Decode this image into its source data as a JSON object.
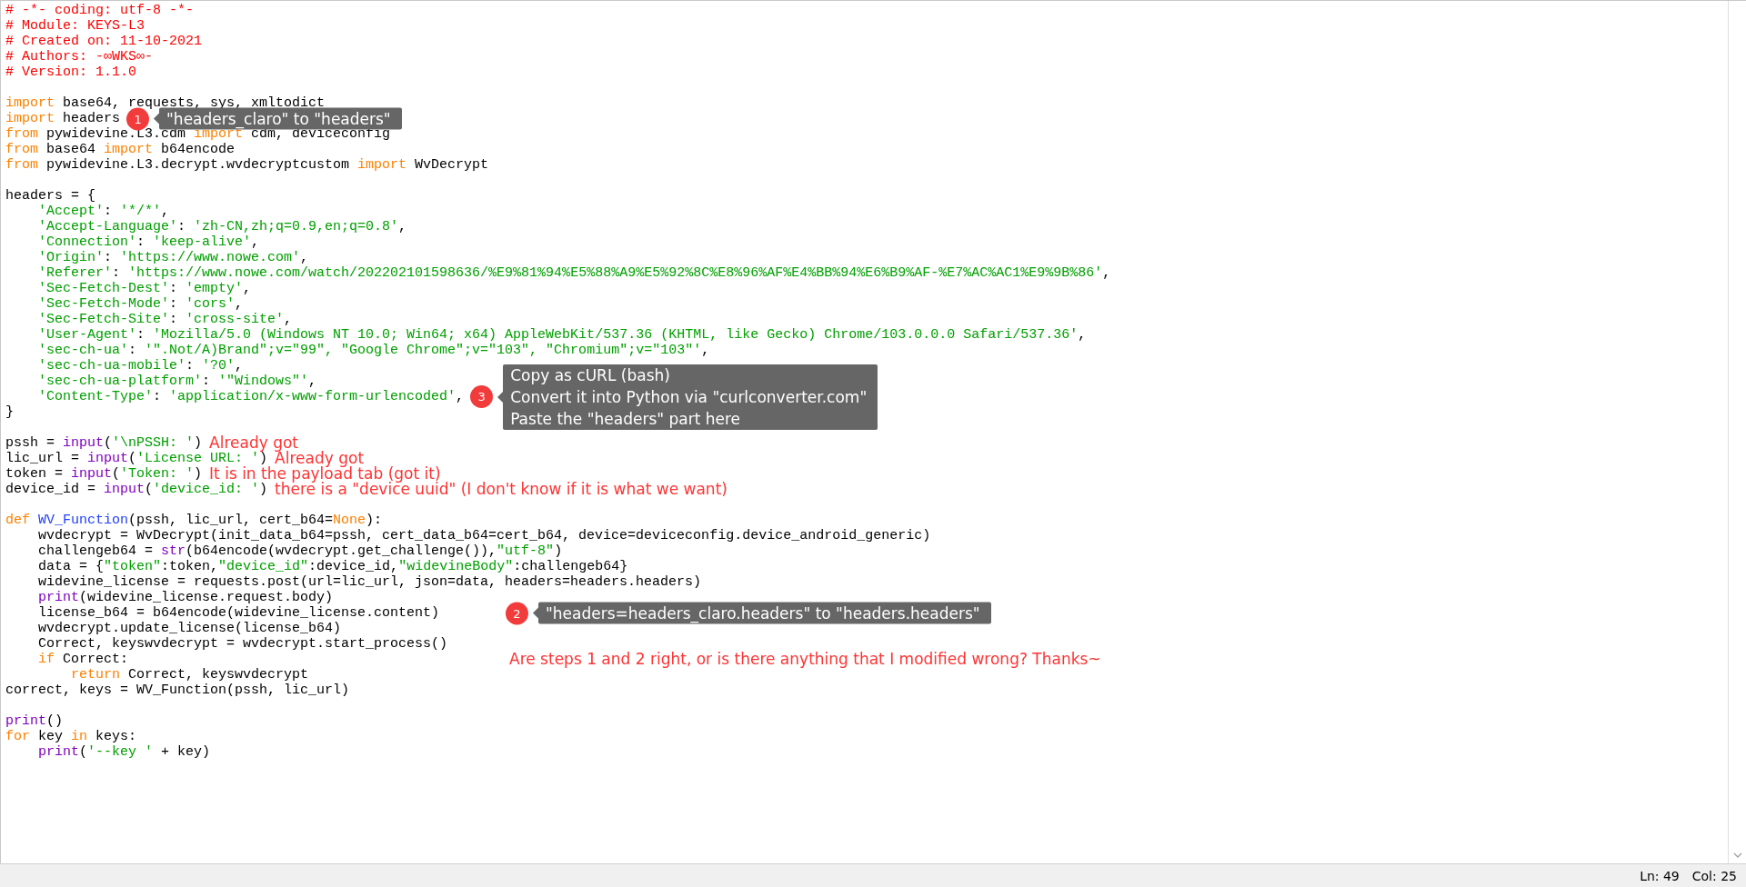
{
  "editor": {
    "lines": [
      {
        "kind": "code",
        "tokens": [
          {
            "kind": "comment",
            "text": "# -*- coding: utf-8 -*-"
          }
        ]
      },
      {
        "kind": "code",
        "tokens": [
          {
            "kind": "comment",
            "text": "# Module: KEYS-L3"
          }
        ]
      },
      {
        "kind": "code",
        "tokens": [
          {
            "kind": "comment",
            "text": "# Created on: 11-10-2021"
          }
        ]
      },
      {
        "kind": "code",
        "tokens": [
          {
            "kind": "comment",
            "text": "# Authors: -∞WKS∞-"
          }
        ]
      },
      {
        "kind": "code",
        "tokens": [
          {
            "kind": "comment",
            "text": "# Version: 1.1.0"
          }
        ]
      },
      {
        "kind": "blank"
      },
      {
        "kind": "code",
        "tokens": [
          {
            "kind": "kw",
            "text": "import"
          },
          {
            "kind": "plain",
            "text": " base64, requests, sys, xmltodict"
          }
        ]
      },
      {
        "kind": "code",
        "tokens": [
          {
            "kind": "kw",
            "text": "import"
          },
          {
            "kind": "plain",
            "text": " headers"
          }
        ],
        "annotation": {
          "kind": "callout",
          "aside": false,
          "number": "1",
          "lines": [
            "\"headers_claro\" to \"headers\""
          ]
        }
      },
      {
        "kind": "code",
        "tokens": [
          {
            "kind": "kw",
            "text": "from"
          },
          {
            "kind": "plain",
            "text": " pywidevine.L3.cdm "
          },
          {
            "kind": "kw",
            "text": "import"
          },
          {
            "kind": "plain",
            "text": " cdm, deviceconfig"
          }
        ]
      },
      {
        "kind": "code",
        "tokens": [
          {
            "kind": "kw",
            "text": "from"
          },
          {
            "kind": "plain",
            "text": " base64 "
          },
          {
            "kind": "kw",
            "text": "import"
          },
          {
            "kind": "plain",
            "text": " b64encode"
          }
        ]
      },
      {
        "kind": "code",
        "tokens": [
          {
            "kind": "kw",
            "text": "from"
          },
          {
            "kind": "plain",
            "text": " pywidevine.L3.decrypt.wvdecryptcustom "
          },
          {
            "kind": "kw",
            "text": "import"
          },
          {
            "kind": "plain",
            "text": " WvDecrypt"
          }
        ]
      },
      {
        "kind": "blank"
      },
      {
        "kind": "code",
        "tokens": [
          {
            "kind": "plain",
            "text": "headers = {"
          }
        ]
      },
      {
        "kind": "code",
        "tokens": [
          {
            "kind": "str",
            "text": "    'Accept'"
          },
          {
            "kind": "plain",
            "text": ": "
          },
          {
            "kind": "str",
            "text": "'*/*'"
          },
          {
            "kind": "plain",
            "text": ","
          }
        ]
      },
      {
        "kind": "code",
        "tokens": [
          {
            "kind": "str",
            "text": "    'Accept-Language'"
          },
          {
            "kind": "plain",
            "text": ": "
          },
          {
            "kind": "str",
            "text": "'zh-CN,zh;q=0.9,en;q=0.8'"
          },
          {
            "kind": "plain",
            "text": ","
          }
        ]
      },
      {
        "kind": "code",
        "tokens": [
          {
            "kind": "str",
            "text": "    'Connection'"
          },
          {
            "kind": "plain",
            "text": ": "
          },
          {
            "kind": "str",
            "text": "'keep-alive'"
          },
          {
            "kind": "plain",
            "text": ","
          }
        ]
      },
      {
        "kind": "code",
        "tokens": [
          {
            "kind": "str",
            "text": "    'Origin'"
          },
          {
            "kind": "plain",
            "text": ": "
          },
          {
            "kind": "str",
            "text": "'https://www.nowe.com'"
          },
          {
            "kind": "plain",
            "text": ","
          }
        ]
      },
      {
        "kind": "code",
        "tokens": [
          {
            "kind": "str",
            "text": "    'Referer'"
          },
          {
            "kind": "plain",
            "text": ": "
          },
          {
            "kind": "str",
            "text": "'https://www.nowe.com/watch/202202101598636/%E9%81%94%E5%88%A9%E5%92%8C%E8%96%AF%E4%BB%94%E6%B9%AF-%E7%AC%AC1%E9%9B%86'"
          },
          {
            "kind": "plain",
            "text": ","
          }
        ]
      },
      {
        "kind": "code",
        "tokens": [
          {
            "kind": "str",
            "text": "    'Sec-Fetch-Dest'"
          },
          {
            "kind": "plain",
            "text": ": "
          },
          {
            "kind": "str",
            "text": "'empty'"
          },
          {
            "kind": "plain",
            "text": ","
          }
        ]
      },
      {
        "kind": "code",
        "tokens": [
          {
            "kind": "str",
            "text": "    'Sec-Fetch-Mode'"
          },
          {
            "kind": "plain",
            "text": ": "
          },
          {
            "kind": "str",
            "text": "'cors'"
          },
          {
            "kind": "plain",
            "text": ","
          }
        ]
      },
      {
        "kind": "code",
        "tokens": [
          {
            "kind": "str",
            "text": "    'Sec-Fetch-Site'"
          },
          {
            "kind": "plain",
            "text": ": "
          },
          {
            "kind": "str",
            "text": "'cross-site'"
          },
          {
            "kind": "plain",
            "text": ","
          }
        ]
      },
      {
        "kind": "code",
        "tokens": [
          {
            "kind": "str",
            "text": "    'User-Agent'"
          },
          {
            "kind": "plain",
            "text": ": "
          },
          {
            "kind": "str",
            "text": "'Mozilla/5.0 (Windows NT 10.0; Win64; x64) AppleWebKit/537.36 (KHTML, like Gecko) Chrome/103.0.0.0 Safari/537.36'"
          },
          {
            "kind": "plain",
            "text": ","
          }
        ]
      },
      {
        "kind": "code",
        "tokens": [
          {
            "kind": "str",
            "text": "    'sec-ch-ua'"
          },
          {
            "kind": "plain",
            "text": ": "
          },
          {
            "kind": "str",
            "text": "'\".Not/A)Brand\";v=\"99\", \"Google Chrome\";v=\"103\", \"Chromium\";v=\"103\"'"
          },
          {
            "kind": "plain",
            "text": ","
          }
        ]
      },
      {
        "kind": "code",
        "tokens": [
          {
            "kind": "str",
            "text": "    'sec-ch-ua-mobile'"
          },
          {
            "kind": "plain",
            "text": ": "
          },
          {
            "kind": "str",
            "text": "'?0'"
          },
          {
            "kind": "plain",
            "text": ","
          }
        ]
      },
      {
        "kind": "code",
        "tokens": [
          {
            "kind": "str",
            "text": "    'sec-ch-ua-platform'"
          },
          {
            "kind": "plain",
            "text": ": "
          },
          {
            "kind": "str",
            "text": "'\"Windows\"'"
          },
          {
            "kind": "plain",
            "text": ","
          }
        ]
      },
      {
        "kind": "code",
        "tokens": [
          {
            "kind": "str",
            "text": "    'Content-Type'"
          },
          {
            "kind": "plain",
            "text": ": "
          },
          {
            "kind": "str",
            "text": "'application/x-www-form-urlencoded'"
          },
          {
            "kind": "plain",
            "text": ","
          }
        ],
        "annotation": {
          "kind": "callout",
          "aside": false,
          "number": "3",
          "lines": [
            "Copy as cURL (bash)",
            "Convert it into Python via \"curlconverter.com\"",
            "Paste the \"headers\" part here"
          ]
        }
      },
      {
        "kind": "code",
        "tokens": [
          {
            "kind": "plain",
            "text": "}"
          }
        ]
      },
      {
        "kind": "blank"
      },
      {
        "kind": "code",
        "tokens": [
          {
            "kind": "plain",
            "text": "pssh = "
          },
          {
            "kind": "builtin",
            "text": "input"
          },
          {
            "kind": "plain",
            "text": "("
          },
          {
            "kind": "str",
            "text": "'\\nPSSH: '"
          },
          {
            "kind": "plain",
            "text": ")"
          }
        ],
        "annotation": {
          "kind": "note",
          "aside": false,
          "text": "Already got"
        }
      },
      {
        "kind": "code",
        "tokens": [
          {
            "kind": "plain",
            "text": "lic_url = "
          },
          {
            "kind": "builtin",
            "text": "input"
          },
          {
            "kind": "plain",
            "text": "("
          },
          {
            "kind": "str",
            "text": "'License URL: '"
          },
          {
            "kind": "plain",
            "text": ")"
          }
        ],
        "annotation": {
          "kind": "note",
          "aside": false,
          "text": "Already got"
        }
      },
      {
        "kind": "code",
        "tokens": [
          {
            "kind": "plain",
            "text": "token = "
          },
          {
            "kind": "builtin",
            "text": "input"
          },
          {
            "kind": "plain",
            "text": "("
          },
          {
            "kind": "str",
            "text": "'Token: '"
          },
          {
            "kind": "plain",
            "text": ")"
          }
        ],
        "annotation": {
          "kind": "note",
          "aside": false,
          "text": "It is in the payload tab (got it)"
        }
      },
      {
        "kind": "code",
        "tokens": [
          {
            "kind": "plain",
            "text": "device_id = "
          },
          {
            "kind": "builtin",
            "text": "input"
          },
          {
            "kind": "plain",
            "text": "("
          },
          {
            "kind": "str",
            "text": "'device_id: '"
          },
          {
            "kind": "plain",
            "text": ")"
          }
        ],
        "annotation": {
          "kind": "note",
          "aside": false,
          "text": "there is a \"device uuid\" (I don't know if it is what we want)"
        }
      },
      {
        "kind": "blank"
      },
      {
        "kind": "code",
        "tokens": [
          {
            "kind": "kw",
            "text": "def"
          },
          {
            "kind": "func",
            "text": " WV_Function"
          },
          {
            "kind": "plain",
            "text": "(pssh, lic_url, cert_b64="
          },
          {
            "kind": "kw",
            "text": "None"
          },
          {
            "kind": "plain",
            "text": "):"
          }
        ]
      },
      {
        "kind": "code",
        "tokens": [
          {
            "kind": "plain",
            "text": "    wvdecrypt = WvDecrypt(init_data_b64=pssh, cert_data_b64=cert_b64, device=deviceconfig.device_android_generic)"
          }
        ]
      },
      {
        "kind": "code",
        "tokens": [
          {
            "kind": "plain",
            "text": "    challengeb64 = "
          },
          {
            "kind": "builtin",
            "text": "str"
          },
          {
            "kind": "plain",
            "text": "(b64encode(wvdecrypt.get_challenge()),"
          },
          {
            "kind": "str",
            "text": "\"utf-8\""
          },
          {
            "kind": "plain",
            "text": ")"
          }
        ]
      },
      {
        "kind": "code",
        "tokens": [
          {
            "kind": "plain",
            "text": "    data = {"
          },
          {
            "kind": "str",
            "text": "\"token\""
          },
          {
            "kind": "plain",
            "text": ":token,"
          },
          {
            "kind": "str",
            "text": "\"device_id\""
          },
          {
            "kind": "plain",
            "text": ":device_id,"
          },
          {
            "kind": "str",
            "text": "\"widevineBody\""
          },
          {
            "kind": "plain",
            "text": ":challengeb64}"
          }
        ]
      },
      {
        "kind": "code",
        "tokens": [
          {
            "kind": "plain",
            "text": "    widevine_license = requests.post(url=lic_url, json=data, headers=headers.headers)"
          }
        ]
      },
      {
        "kind": "code",
        "tokens": [
          {
            "kind": "builtin",
            "text": "    print"
          },
          {
            "kind": "plain",
            "text": "(widevine_license.request.body)"
          }
        ]
      },
      {
        "kind": "code",
        "tokens": [
          {
            "kind": "plain",
            "text": "    license_b64 = b64encode(widevine_license.content)"
          }
        ],
        "annotation": {
          "kind": "callout",
          "aside": true,
          "number": "2",
          "lines": [
            "\"headers=headers_claro.headers\" to \"headers.headers\""
          ]
        }
      },
      {
        "kind": "code",
        "tokens": [
          {
            "kind": "plain",
            "text": "    wvdecrypt.update_license(license_b64)"
          }
        ]
      },
      {
        "kind": "code",
        "tokens": [
          {
            "kind": "plain",
            "text": "    Correct, keyswvdecrypt = wvdecrypt.start_process()"
          }
        ]
      },
      {
        "kind": "code",
        "tokens": [
          {
            "kind": "kw",
            "text": "    if"
          },
          {
            "kind": "plain",
            "text": " Correct:"
          }
        ],
        "annotation": {
          "kind": "note",
          "aside": true,
          "text": "Are steps 1 and 2 right, or is there anything that I modified wrong? Thanks~"
        }
      },
      {
        "kind": "code",
        "tokens": [
          {
            "kind": "kw",
            "text": "        return"
          },
          {
            "kind": "plain",
            "text": " Correct, keyswvdecrypt"
          }
        ]
      },
      {
        "kind": "code",
        "tokens": [
          {
            "kind": "plain",
            "text": "correct, keys = WV_Function(pssh, lic_url)"
          }
        ]
      },
      {
        "kind": "blank"
      },
      {
        "kind": "code",
        "tokens": [
          {
            "kind": "builtin",
            "text": "print"
          },
          {
            "kind": "plain",
            "text": "()"
          }
        ]
      },
      {
        "kind": "code",
        "tokens": [
          {
            "kind": "kw",
            "text": "for"
          },
          {
            "kind": "plain",
            "text": " key "
          },
          {
            "kind": "kw",
            "text": "in"
          },
          {
            "kind": "plain",
            "text": " keys:"
          }
        ]
      },
      {
        "kind": "code",
        "tokens": [
          {
            "kind": "builtin",
            "text": "    print"
          },
          {
            "kind": "plain",
            "text": "("
          },
          {
            "kind": "str",
            "text": "'--key '"
          },
          {
            "kind": "plain",
            "text": " + key)"
          }
        ]
      }
    ]
  },
  "status_bar": {
    "line": "Ln: 49",
    "column": "Col: 25"
  }
}
